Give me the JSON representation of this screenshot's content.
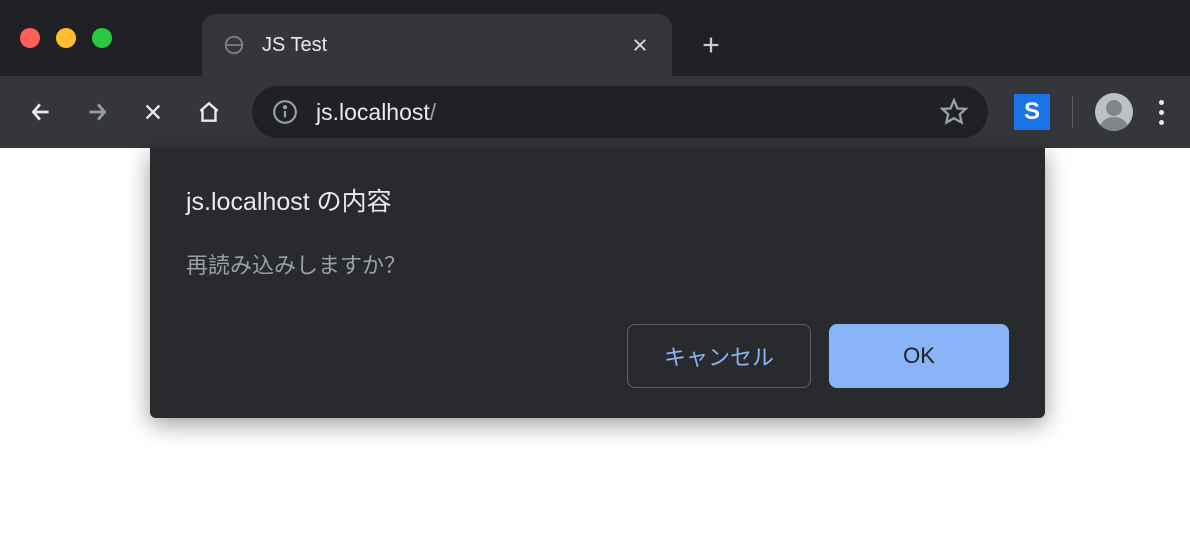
{
  "tab": {
    "title": "JS Test"
  },
  "address": {
    "host": "js.localhost",
    "path": "/"
  },
  "dialog": {
    "title": "js.localhost の内容",
    "message": "再読み込みしますか？",
    "cancel_label": "キャンセル",
    "ok_label": "OK"
  },
  "extension": {
    "letter": "S"
  }
}
